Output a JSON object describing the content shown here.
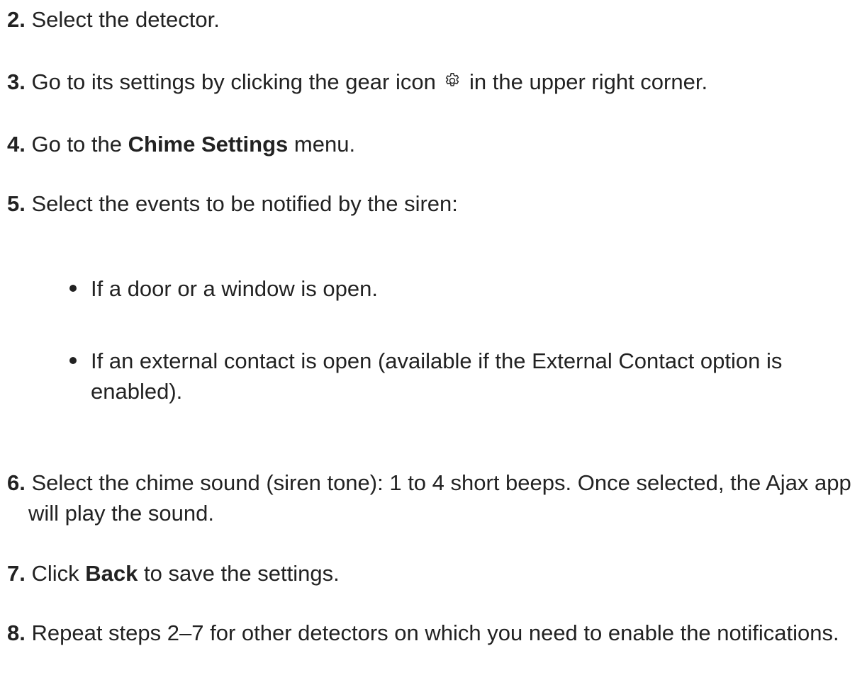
{
  "steps": {
    "s2": {
      "num": "2.",
      "text": " Select the detector."
    },
    "s3": {
      "num": "3.",
      "before": " Go to its settings by clicking the gear icon ",
      "icon": "gear-icon",
      "after": " in the upper right corner."
    },
    "s4": {
      "num": "4.",
      "before": " Go to the ",
      "bold": "Chime Settings",
      "after": " menu."
    },
    "s5": {
      "num": "5.",
      "text": " Select the events to be notified by the siren:"
    },
    "s6": {
      "num": "6.",
      "text": " Select the chime sound (siren tone): 1 to 4 short beeps. Once selected, the Ajax app will play the sound."
    },
    "s7": {
      "num": "7.",
      "before": " Click ",
      "bold": "Back",
      "after": " to save the settings."
    },
    "s8": {
      "num": "8.",
      "text": " Repeat steps 2–7 for other detectors on which you need to enable the notifications."
    }
  },
  "bullets": [
    "If a door or a window is open.",
    "If an external contact is open (available if the External Contact option is enabled)."
  ]
}
